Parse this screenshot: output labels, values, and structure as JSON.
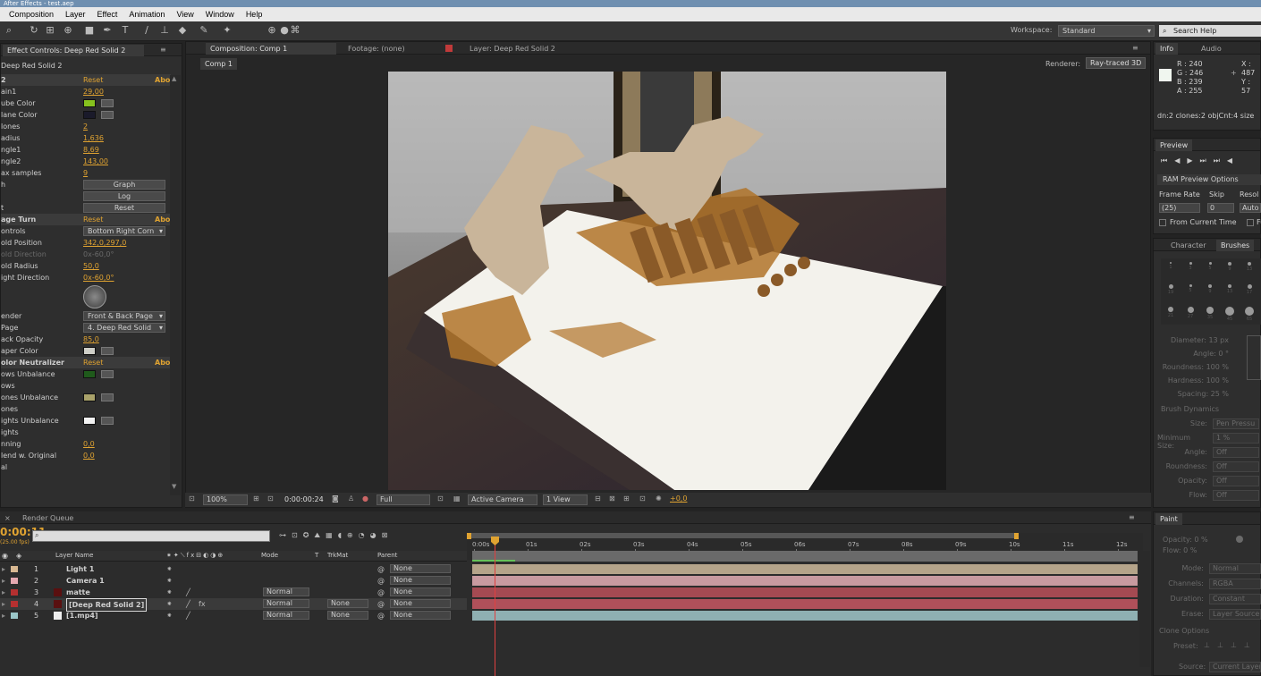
{
  "titlebar": {
    "title": "After Effects - test.aep"
  },
  "menu": [
    "Composition",
    "Layer",
    "Effect",
    "Animation",
    "View",
    "Window",
    "Help"
  ],
  "workspace": {
    "label": "Workspace:",
    "value": "Standard"
  },
  "search_help": {
    "placeholder": "Search Help"
  },
  "effect_controls": {
    "tab": "Effect Controls: Deep Red Solid 2",
    "subtitle": "Deep Red Solid 2",
    "rows": [
      {
        "type": "head",
        "label": "2",
        "val": "Reset",
        "abo": "Abo"
      },
      {
        "type": "val",
        "label": "ain1",
        "val": "29,00"
      },
      {
        "type": "color",
        "label": "ube Color",
        "color": "#86c21e"
      },
      {
        "type": "color",
        "label": "lane Color",
        "color": "#1a1a2a"
      },
      {
        "type": "val",
        "label": "lones",
        "val": "2"
      },
      {
        "type": "val",
        "label": "adius",
        "val": "1,636"
      },
      {
        "type": "val",
        "label": "ngle1",
        "val": "8,69"
      },
      {
        "type": "val",
        "label": "ngle2",
        "val": "143,00"
      },
      {
        "type": "val",
        "label": "ax samples",
        "val": "9"
      },
      {
        "type": "btn",
        "label": "h",
        "btn": "Graph"
      },
      {
        "type": "btn",
        "label": "",
        "btn": "Log"
      },
      {
        "type": "btn",
        "label": "t",
        "btn": "Reset"
      },
      {
        "type": "head",
        "label": "age Turn",
        "val": "Reset",
        "abo": "Abo"
      },
      {
        "type": "dd",
        "label": "ontrols",
        "dd": "Bottom Right Corn"
      },
      {
        "type": "val",
        "label": "old Position",
        "val": "342,0,297,0"
      },
      {
        "type": "dim",
        "label": "old Direction",
        "val": "0x-60,0°"
      },
      {
        "type": "val",
        "label": "old Radius",
        "val": "50,0"
      },
      {
        "type": "val",
        "label": "ight Direction",
        "val": "0x-60,0°"
      },
      {
        "type": "dial",
        "label": ""
      },
      {
        "type": "dd",
        "label": "ender",
        "dd": "Front & Back Page"
      },
      {
        "type": "dd",
        "label": "Page",
        "dd": "4. Deep Red Solid"
      },
      {
        "type": "val",
        "label": "ack Opacity",
        "val": "85,0"
      },
      {
        "type": "color",
        "label": "aper Color",
        "color": "#cfcfc8"
      },
      {
        "type": "head",
        "label": "olor Neutralizer",
        "val": "Reset",
        "abo": "Abo"
      },
      {
        "type": "color",
        "label": "ows Unbalance",
        "color": "#1f5a1b"
      },
      {
        "type": "val",
        "label": "ows",
        "val": ""
      },
      {
        "type": "color",
        "label": "ones Unbalance",
        "color": "#a9a26a"
      },
      {
        "type": "val",
        "label": "ones",
        "val": ""
      },
      {
        "type": "color",
        "label": "ights Unbalance",
        "color": "#f2f2f2"
      },
      {
        "type": "val",
        "label": "ights",
        "val": ""
      },
      {
        "type": "val",
        "label": "nning",
        "val": "0,0"
      },
      {
        "type": "val",
        "label": "lend w. Original",
        "val": "0,0"
      },
      {
        "type": "val",
        "label": "al",
        "val": ""
      }
    ]
  },
  "comp_tabs": {
    "composition": "Composition: Comp 1",
    "footage": "Footage: (none)",
    "layer": "Layer: Deep Red Solid 2",
    "comp_name": "Comp 1",
    "renderer_label": "Renderer:",
    "renderer": "Ray-traced 3D"
  },
  "comp_footer": {
    "zoom": "100%",
    "timecode": "0:00:00:24",
    "resolution": "Full",
    "camera": "Active Camera",
    "view": "1 View",
    "exposure": "+0,0"
  },
  "info": {
    "tab": "Info",
    "tab2": "Audio",
    "r": "R : 240",
    "g": "G : 246",
    "b": "B : 239",
    "a": "A : 255",
    "x": "X : 487",
    "y": "Y : 57",
    "status": "dn:2 clones:2 objCnt:4 size"
  },
  "preview": {
    "tab": "Preview",
    "ram": "RAM Preview Options",
    "frame_rate_label": "Frame Rate",
    "skip_label": "Skip",
    "resolution_label": "Resol",
    "frame_rate": "(25)",
    "skip": "0",
    "resolution": "Auto",
    "from_current": "From Current Time",
    "full": "Fu"
  },
  "brushes": {
    "tab": "Character",
    "tab2": "Brushes",
    "sizes": [
      "1",
      "3",
      "5",
      "9",
      "13",
      "19",
      "5",
      "9",
      "13",
      "17",
      "21",
      "27",
      "35",
      "45",
      "65"
    ],
    "props": [
      "Diameter: 13 px",
      "Angle: 0 °",
      "Roundness: 100 %",
      "Hardness: 100 %",
      "Spacing: 25 %"
    ],
    "dynamics": "Brush Dynamics",
    "dyn_rows": [
      [
        "Size:",
        "Pen Pressu"
      ],
      [
        "Minimum Size:",
        "1 %"
      ],
      [
        "Angle:",
        "Off"
      ],
      [
        "Roundness:",
        "Off"
      ],
      [
        "Opacity:",
        "Off"
      ],
      [
        "Flow:",
        "Off"
      ]
    ]
  },
  "paint": {
    "tab": "Paint",
    "opacity": "Opacity: 0 %",
    "flow": "Flow: 0 %",
    "mode": [
      "Mode:",
      "Normal"
    ],
    "channels": [
      "Channels:",
      "RGBA"
    ],
    "duration": [
      "Duration:",
      "Constant"
    ],
    "erase": [
      "Erase:",
      "Layer Source & P"
    ],
    "clone": "Clone Options",
    "preset": "Preset:",
    "source": [
      "Source:",
      "Current Layer"
    ]
  },
  "timeline": {
    "tab": "Render Queue",
    "timecode": "0:00:11",
    "fps": "(25.00 fps)",
    "search_placeholder": "",
    "col_layer_name": "Layer Name",
    "col_mode": "Mode",
    "col_t": "T",
    "col_trkmat": "TrkMat",
    "col_parent": "Parent",
    "ruler": [
      "0:00s",
      "01s",
      "02s",
      "03s",
      "04s",
      "05s",
      "06s",
      "07s",
      "08s",
      "09s",
      "10s",
      "11s",
      "12s"
    ],
    "layers": [
      {
        "num": "1",
        "name": "Light 1",
        "label_color": "#d8b892",
        "track_color": "#b5a48a",
        "mode": "",
        "trkmat": "",
        "parent": "None"
      },
      {
        "num": "2",
        "name": "Camera 1",
        "label_color": "#e5a8b0",
        "track_color": "#c89aa0",
        "mode": "",
        "trkmat": "",
        "parent": "None"
      },
      {
        "num": "3",
        "name": "matte",
        "label_color": "#b53030",
        "track_color": "#a44a52",
        "mode": "Normal",
        "trkmat": "",
        "parent": "None"
      },
      {
        "num": "4",
        "name": "[Deep Red Solid 2]",
        "label_color": "#b53030",
        "track_color": "#b0505a",
        "mode": "Normal",
        "trkmat": "None",
        "parent": "None"
      },
      {
        "num": "5",
        "name": "[1.mp4]",
        "label_color": "#9bc6c8",
        "track_color": "#8fb0b2",
        "mode": "Normal",
        "trkmat": "None",
        "parent": "None"
      }
    ]
  }
}
